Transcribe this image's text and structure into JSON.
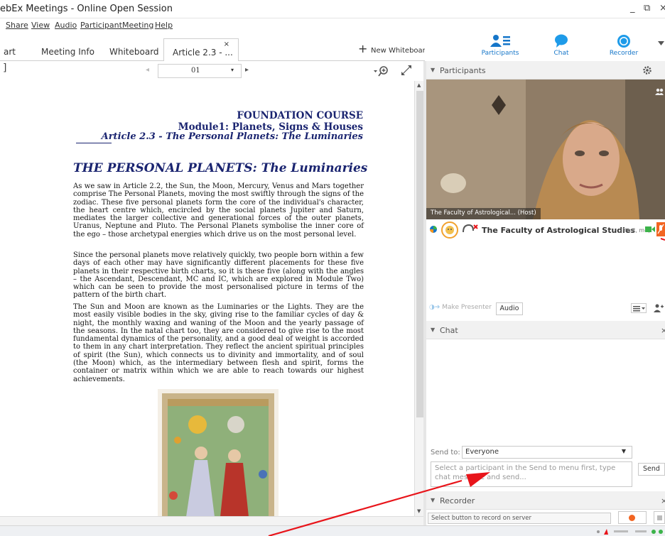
{
  "window": {
    "title": "ebEx Meetings - Online Open Session",
    "minimize": "_",
    "restore": "⧉",
    "close": "×"
  },
  "menu": [
    "Share",
    "View",
    "Audio",
    "Participant",
    "Meeting",
    "Help"
  ],
  "tabs": {
    "t0": "art",
    "t1": "Meeting Info",
    "t2": "Whiteboard",
    "t3": "Article 2.3 - ...",
    "t3_close": "×",
    "new_whiteboard": "New Whiteboard",
    "new_plus": "+"
  },
  "top_buttons": {
    "participants": "Participants",
    "chat": "Chat",
    "recorder": "Recorder"
  },
  "doc_toolbar": {
    "page": "01",
    "left": "◂",
    "right": "▸",
    "caret": "▾"
  },
  "document": {
    "h1": "FOUNDATION COURSE",
    "h2": "Module1: Planets, Signs & Houses",
    "h3": "Article 2.3 - The Personal Planets: The Luminaries",
    "title": "THE PERSONAL PLANETS: The Luminaries",
    "p1": "As we saw in Article 2.2, the Sun, the Moon, Mercury, Venus and Mars together comprise The Personal Planets, moving the most swiftly through the signs of the zodiac. These five personal planets form the core of the individual's character, the heart centre which, encircled by the social planets Jupiter and Saturn, mediates the larger collective and generational forces of the outer planets, Uranus, Neptune and Pluto. The Personal Planets symbolise the inner core of the ego – those archetypal energies which drive us on the most personal level.",
    "p2": "Since the personal planets move relatively quickly, two people born within a few days of each other may have significantly different placements for these five planets in their respective birth charts, so it is these five (along with the angles – the Ascendant, Descendant, MC and IC, which are explored in Module Two) which can be seen to provide the most personalised picture in terms of the pattern of the birth chart.",
    "p3": "The Sun and Moon are known as the Luminaries or the Lights. They are the most easily visible bodies in the sky, giving rise to the familiar cycles of day & night, the monthly waxing and waning of the Moon and the yearly passage of the seasons. In the natal chart too, they are considered to give rise to the most fundamental dynamics of the personality, and a good deal of weight is accorded to them in any chart interpretation. They reflect the ancient spiritual principles of spirit (the Sun), which connects us to divinity and immortality, and of soul (the Moon) which, as the intermediary between flesh and spirit, forms the container or matrix within which we are able to reach towards our highest achievements."
  },
  "participants_panel": {
    "header": "Participants",
    "video_label": "The Faculty of Astrological... (Host)",
    "name": "The Faculty of Astrological Studies",
    "name_suffix": "(Host, me)",
    "make_presenter": "Make Presenter",
    "audio_button": "Audio"
  },
  "chat_panel": {
    "header": "Chat",
    "send_to_label": "Send to:",
    "send_to_value": "Everyone",
    "input_placeholder": "Select a participant in the Send to menu first, type chat message and send...",
    "send_button": "Send"
  },
  "recorder_panel": {
    "header": "Recorder",
    "status": "Select button to record on server"
  },
  "colors": {
    "accent": "#1576c9",
    "heading": "#1a2470",
    "annotation_arrow": "#e8141a",
    "record": "#f26522"
  }
}
